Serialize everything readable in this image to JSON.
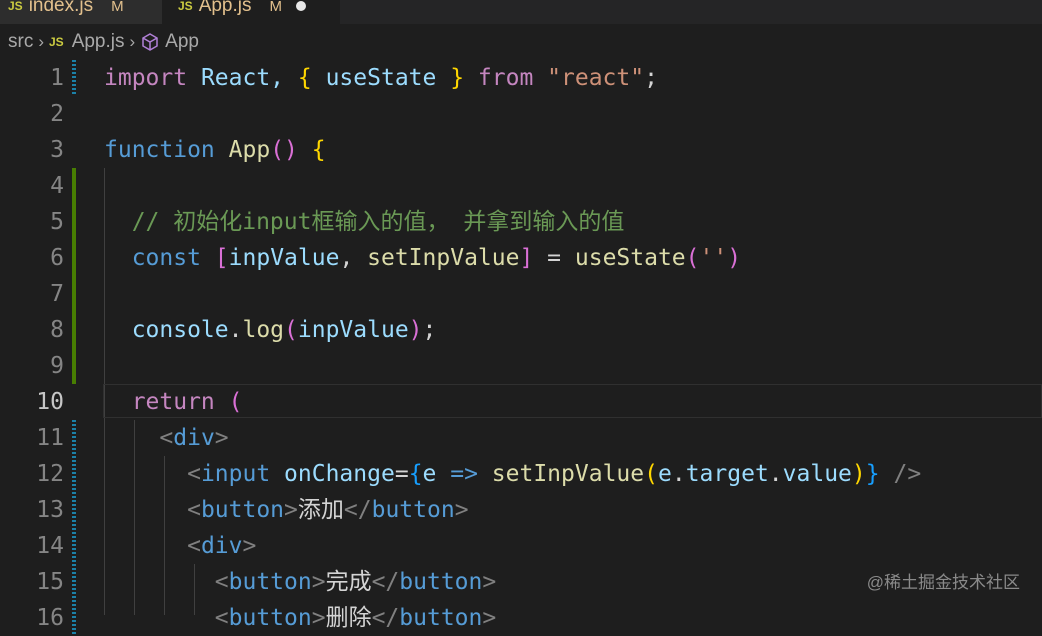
{
  "tabs": [
    {
      "name": "index.js",
      "status": "M",
      "active": false
    },
    {
      "name": "App.js",
      "status": "M",
      "active": true,
      "dirty": true
    }
  ],
  "breadcrumb": {
    "folder": "src",
    "file": "App.js",
    "file_icon": "JS",
    "symbol": "App"
  },
  "editor": {
    "current_line": 10,
    "lines": [
      {
        "n": "1",
        "t1": "import",
        "t2": " React, ",
        "t3": "{",
        "t4": " useState ",
        "t5": "}",
        "t6": " from ",
        "t7": "\"react\"",
        "t8": ";"
      },
      {
        "n": "2"
      },
      {
        "n": "3",
        "t1": "function",
        "t2": " ",
        "t3": "App",
        "t4": "()",
        "t5": " ",
        "t6": "{"
      },
      {
        "n": "4"
      },
      {
        "n": "5",
        "text": "  // 初始化input框输入的值， 并拿到输入的值"
      },
      {
        "n": "6",
        "t1": "  const",
        "t2": " ",
        "t3": "[",
        "t4": "inpValue",
        "t5": ", ",
        "t6": "setInpValue",
        "t7": "]",
        "t8": " = ",
        "t9": "useState",
        "t10": "(",
        "t11": "''",
        "t12": ")"
      },
      {
        "n": "7"
      },
      {
        "n": "8",
        "t1": "  console",
        "t2": ".",
        "t3": "log",
        "t4": "(",
        "t5": "inpValue",
        "t6": ")",
        "t7": ";"
      },
      {
        "n": "9"
      },
      {
        "n": "10",
        "t1": "  return",
        "t2": " ",
        "t3": "("
      },
      {
        "n": "11",
        "t1": "    <",
        "t2": "div",
        "t3": ">"
      },
      {
        "n": "12",
        "t1": "      <",
        "t2": "input",
        "t3": " ",
        "t4": "onChange",
        "t5": "=",
        "t6": "{",
        "t7": "e",
        "t8": " => ",
        "t9": "setInpValue",
        "t10": "(",
        "t11": "e",
        "t12": ".",
        "t13": "target",
        "t14": ".",
        "t15": "value",
        "t16": ")",
        "t17": "}",
        "t18": " ",
        "t19": "/>"
      },
      {
        "n": "13",
        "t1": "      <",
        "t2": "button",
        "t3": ">",
        "t4": "添加",
        "t5": "</",
        "t6": "button",
        "t7": ">"
      },
      {
        "n": "14",
        "t1": "      <",
        "t2": "div",
        "t3": ">"
      },
      {
        "n": "15",
        "t1": "        <",
        "t2": "button",
        "t3": ">",
        "t4": "完成",
        "t5": "</",
        "t6": "button",
        "t7": ">"
      },
      {
        "n": "16",
        "t1": "        <",
        "t2": "button",
        "t3": ">",
        "t4": "删除",
        "t5": "</",
        "t6": "button",
        "t7": ">"
      }
    ]
  },
  "watermark": "@稀土掘金技术社区",
  "colors": {
    "background": "#1e1e1e",
    "keyword": "#569cd6",
    "control": "#c586c0",
    "variable": "#9cdcfe",
    "function": "#dcdcaa",
    "string": "#ce9178",
    "comment": "#6a9955",
    "git_added": "#487e02",
    "git_modified": "#1b81a8"
  }
}
